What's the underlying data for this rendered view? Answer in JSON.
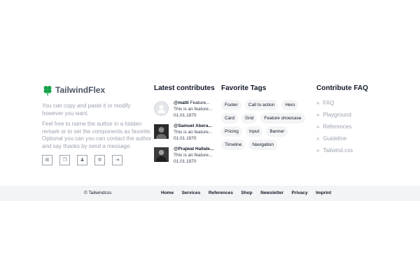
{
  "brand": {
    "name": "TailwindFlex",
    "logo_icon": "clover-icon",
    "accent": "#16a34a",
    "paragraph1": "You can copy and paste it or modify however you want.",
    "paragraph2": "Feel free to name the author in a hidden remark or to set the components as favorite. Optional you can you can contact the author and say thanks by send a message.",
    "social": [
      {
        "icon": "globe-icon",
        "glyph": "⊞"
      },
      {
        "icon": "copy-icon",
        "glyph": "❐"
      },
      {
        "icon": "user-icon",
        "glyph": "♟"
      },
      {
        "icon": "settings-icon",
        "glyph": "✲"
      },
      {
        "icon": "login-icon",
        "glyph": "⇥"
      }
    ]
  },
  "contributes": {
    "title": "Latest contributes",
    "items": [
      {
        "user": "@matti",
        "title": "Feature...",
        "message": "This is an feature...",
        "date": "01.01.1970"
      },
      {
        "user": "@Samuel Abera...",
        "title": "",
        "message": "This is an feature...",
        "date": "01.01.1970"
      },
      {
        "user": "@Prajwal Hallale...",
        "title": "",
        "message": "This is an feature...",
        "date": "01.01.1970"
      }
    ]
  },
  "tags": {
    "title": "Favorite Tags",
    "items": [
      "Footer",
      "Call to action",
      "Hero",
      "Card",
      "Grid",
      "Feature showcase",
      "Pricing",
      "Input",
      "Banner",
      "Timeline",
      "Navigation"
    ]
  },
  "faq": {
    "title": "Contribute FAQ",
    "items": [
      "FAQ",
      "Playground",
      "References",
      "Guideline",
      "Tailwind.css"
    ]
  },
  "bottom": {
    "copyright": "© Tailwindcss",
    "nav": [
      "Home",
      "Services",
      "References",
      "Shop",
      "Newsletter",
      "Privacy",
      "Imprint"
    ]
  }
}
